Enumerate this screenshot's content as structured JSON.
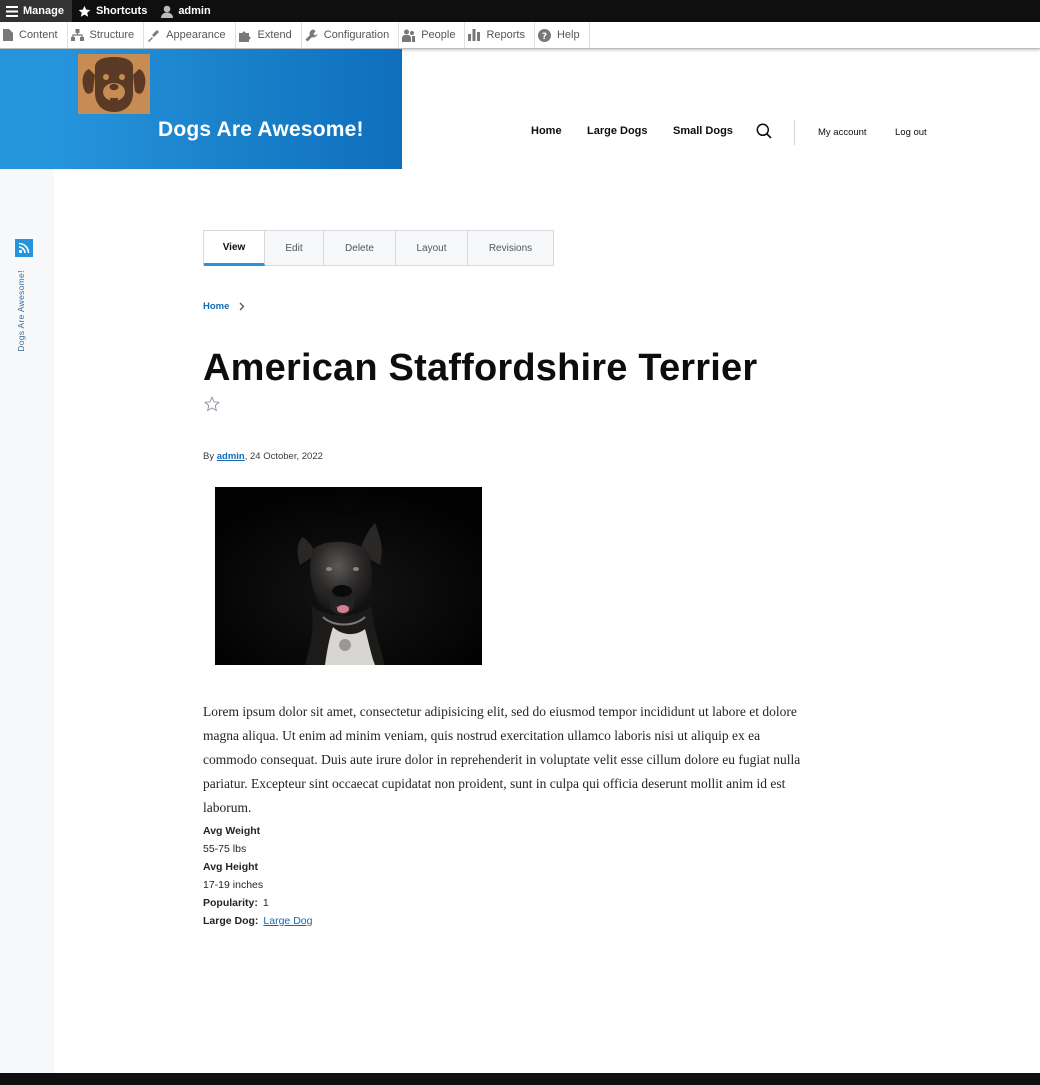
{
  "admin_toolbar": {
    "manage": "Manage",
    "shortcuts": "Shortcuts",
    "user": "admin"
  },
  "admin_tray": {
    "items": [
      {
        "label": "Content",
        "icon": "document-icon"
      },
      {
        "label": "Structure",
        "icon": "structure-icon"
      },
      {
        "label": "Appearance",
        "icon": "brush-icon"
      },
      {
        "label": "Extend",
        "icon": "puzzle-icon"
      },
      {
        "label": "Configuration",
        "icon": "wrench-icon"
      },
      {
        "label": "People",
        "icon": "people-icon"
      },
      {
        "label": "Reports",
        "icon": "bar-chart-icon"
      },
      {
        "label": "Help",
        "icon": "help-icon"
      }
    ]
  },
  "sidebar": {
    "label": "Dogs Are Awesome!"
  },
  "site": {
    "name": "Dogs Are Awesome!",
    "logo": "dog-face-icon",
    "brand_color": "#1a82cb"
  },
  "main_nav": {
    "home": "Home",
    "large_dogs": "Large Dogs",
    "small_dogs": "Small Dogs",
    "my_account": "My account",
    "log_out": "Log out"
  },
  "tabs": [
    {
      "label": "View",
      "active": true
    },
    {
      "label": "Edit",
      "active": false
    },
    {
      "label": "Delete",
      "active": false
    },
    {
      "label": "Layout",
      "active": false
    },
    {
      "label": "Revisions",
      "active": false
    }
  ],
  "breadcrumb": {
    "home": "Home"
  },
  "article": {
    "title": "American Staffordshire Terrier",
    "byline_prefix": "By",
    "author": "admin",
    "date": ", 24 October, 2022",
    "body": "Lorem ipsum dolor sit amet, consectetur adipisicing elit, sed do eiusmod tempor incididunt ut labore et dolore magna aliqua. Ut enim ad minim veniam, quis nostrud exercitation ullamco laboris nisi ut aliquip ex ea commodo consequat. Duis aute irure dolor in reprehenderit in voluptate velit esse cillum dolore eu fugiat nulla pariatur. Excepteur sint occaecat cupidatat non proident, sunt in culpa qui officia deserunt mollit anim id est laborum."
  },
  "fields": {
    "avg_weight_label": "Avg Weight",
    "avg_weight_value": "55-75 lbs",
    "avg_height_label": "Avg Height",
    "avg_height_value": "17-19 inches",
    "popularity_label": "Popularity:",
    "popularity_value": "1",
    "large_dog_label": "Large Dog:",
    "large_dog_value": "Large Dog"
  }
}
